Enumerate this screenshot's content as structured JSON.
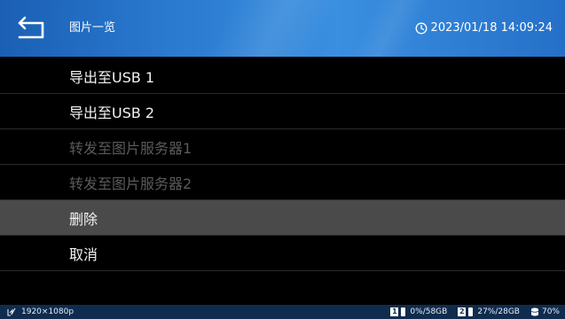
{
  "header": {
    "title": "图片一览",
    "datetime": "2023/01/18 14:09:24"
  },
  "menu": {
    "items": [
      {
        "label": "导出至USB 1",
        "state": "enabled"
      },
      {
        "label": "导出至USB 2",
        "state": "enabled"
      },
      {
        "label": "转发至图片服务器1",
        "state": "disabled"
      },
      {
        "label": "转发至图片服务器2",
        "state": "disabled"
      },
      {
        "label": "删除",
        "state": "selected"
      },
      {
        "label": "取消",
        "state": "enabled"
      }
    ]
  },
  "status": {
    "resolution": "1920×1080p",
    "usb1_slot": "1",
    "usb1_usage": "0%/58GB",
    "usb2_slot": "2",
    "usb2_usage": "27%/28GB",
    "storage_usage": "70%"
  },
  "colors": {
    "header_blue": "#2a7ad0",
    "statusbar": "#0f2c4e",
    "selected_row": "#4a4a4a",
    "disabled_text": "#5a5a5a"
  }
}
